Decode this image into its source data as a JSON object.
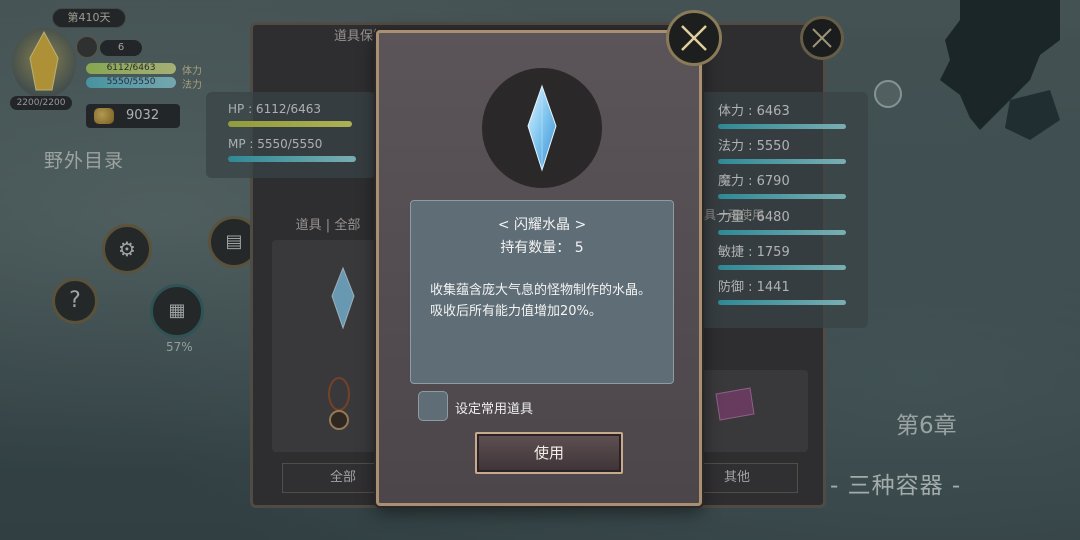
{
  "hud": {
    "day": "第410天",
    "orb_count": "2200/2200",
    "counter": "6",
    "hp_text": "6112/6463",
    "mp_text": "5550/5550",
    "stamina_label": "体力",
    "mana_label": "法力",
    "gold": "9032",
    "area_title": "野外目录",
    "help_icon": "?",
    "progress_percent": "57%"
  },
  "back_window": {
    "title": "道具保管",
    "hp_label": "HP : 6112/6463",
    "mp_label": "MP : 5550/5550",
    "category_tab": "道具 | 全部",
    "right_partial_label": "具一可使用",
    "bottom_tab_all": "全部",
    "bottom_tab_other": "其他"
  },
  "stats": [
    {
      "label": "体力 : 6463"
    },
    {
      "label": "法力 : 5550"
    },
    {
      "label": "魔力 : 6790"
    },
    {
      "label": "力量 : 6480"
    },
    {
      "label": "敏捷 : 1759"
    },
    {
      "label": "防御 : 1441"
    }
  ],
  "chapter": {
    "number": "第6章",
    "subtitle": "- 三种容器 -"
  },
  "modal": {
    "item_name": "< 闪耀水晶 >",
    "quantity": "持有数量：  5",
    "description": "收集蕴含庞大气息的怪物制作的水晶。吸收后所有能力值增加20%。",
    "checkbox_label": "设定常用道具",
    "use_button": "使用"
  },
  "colors": {
    "hp_bar": "#e4f06a",
    "mp_bar": "#7ed8e4",
    "frame_gold": "#a89070"
  }
}
